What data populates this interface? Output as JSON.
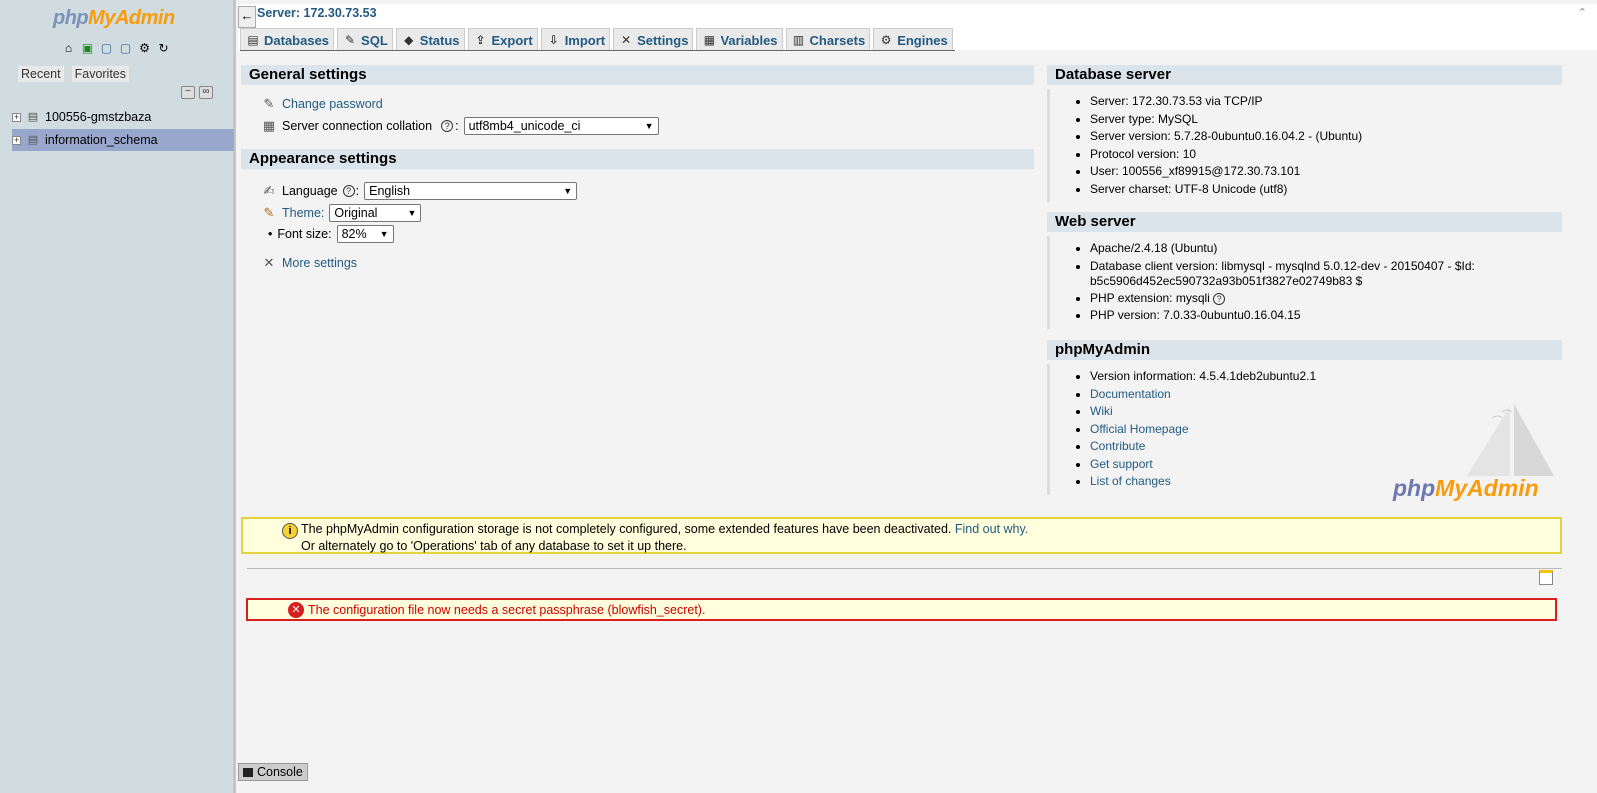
{
  "logo": {
    "php": "php",
    "my": "My",
    "admin": "Admin"
  },
  "nav": {
    "icons": [
      "home-icon",
      "logout-icon",
      "query-window-icon",
      "docs-icon",
      "settings-icon",
      "reload-icon"
    ],
    "recent_label": "Recent",
    "favorites_label": "Favorites",
    "collapse_label": "−",
    "link_label": "∞",
    "databases": [
      {
        "name": "100556-gmstzbaza",
        "selected": false
      },
      {
        "name": "information_schema",
        "selected": true
      }
    ]
  },
  "topbar": {
    "server_label": "Server: 172.30.73.53",
    "back_label": "←",
    "collapse_label": "⌃"
  },
  "tabs": [
    {
      "label": "Databases",
      "icon": "databases-icon"
    },
    {
      "label": "SQL",
      "icon": "sql-icon"
    },
    {
      "label": "Status",
      "icon": "status-icon"
    },
    {
      "label": "Export",
      "icon": "export-icon"
    },
    {
      "label": "Import",
      "icon": "import-icon"
    },
    {
      "label": "Settings",
      "icon": "settings-icon"
    },
    {
      "label": "Variables",
      "icon": "variables-icon"
    },
    {
      "label": "Charsets",
      "icon": "charsets-icon"
    },
    {
      "label": "Engines",
      "icon": "engines-icon"
    }
  ],
  "general": {
    "title": "General settings",
    "change_password": "Change password",
    "collation_label": "Server connection collation",
    "collation_value": "utf8mb4_unicode_ci"
  },
  "appearance": {
    "title": "Appearance settings",
    "language_label": "Language",
    "language_value": "English",
    "theme_label": "Theme:",
    "theme_value": "Original",
    "fontsize_label": "Font size:",
    "fontsize_value": "82%",
    "more_settings": "More settings"
  },
  "db_server": {
    "title": "Database server",
    "items": [
      "Server: 172.30.73.53 via TCP/IP",
      "Server type: MySQL",
      "Server version: 5.7.28-0ubuntu0.16.04.2 - (Ubuntu)",
      "Protocol version: 10",
      "User: 100556_xf89915@172.30.73.101",
      "Server charset: UTF-8 Unicode (utf8)"
    ]
  },
  "web_server": {
    "title": "Web server",
    "item1": "Apache/2.4.18 (Ubuntu)",
    "item2_line1": "Database client version: libmysql - mysqlnd 5.0.12-dev - 20150407 - $Id:",
    "item2_line2": "b5c5906d452ec590732a93b051f3827e02749b83 $",
    "item3": "PHP extension: mysqli",
    "item4": "PHP version: 7.0.33-0ubuntu0.16.04.15"
  },
  "pma": {
    "title": "phpMyAdmin",
    "version": "Version information: 4.5.4.1deb2ubuntu2.1",
    "links": [
      "Documentation",
      "Wiki",
      "Official Homepage",
      "Contribute",
      "Get support",
      "List of changes"
    ],
    "logo_php": "php",
    "logo_rest": "MyAdmin"
  },
  "notice": {
    "line1": "The phpMyAdmin configuration storage is not completely configured, some extended features have been deactivated.",
    "link": "Find out why.",
    "line2": "Or alternately go to 'Operations' tab of any database to set it up there."
  },
  "error": {
    "text": "The configuration file now needs a secret passphrase (blowfish_secret)."
  },
  "console": {
    "label": "Console"
  },
  "colors": {
    "nav_bg": "#d0dce0",
    "selected_db": "#99a7cc",
    "link": "#235a81",
    "panel_header": "#dbe4ea",
    "notice_border": "#e2d43a",
    "error_border": "#d81f1f",
    "logo_orange": "#f89c0e"
  }
}
